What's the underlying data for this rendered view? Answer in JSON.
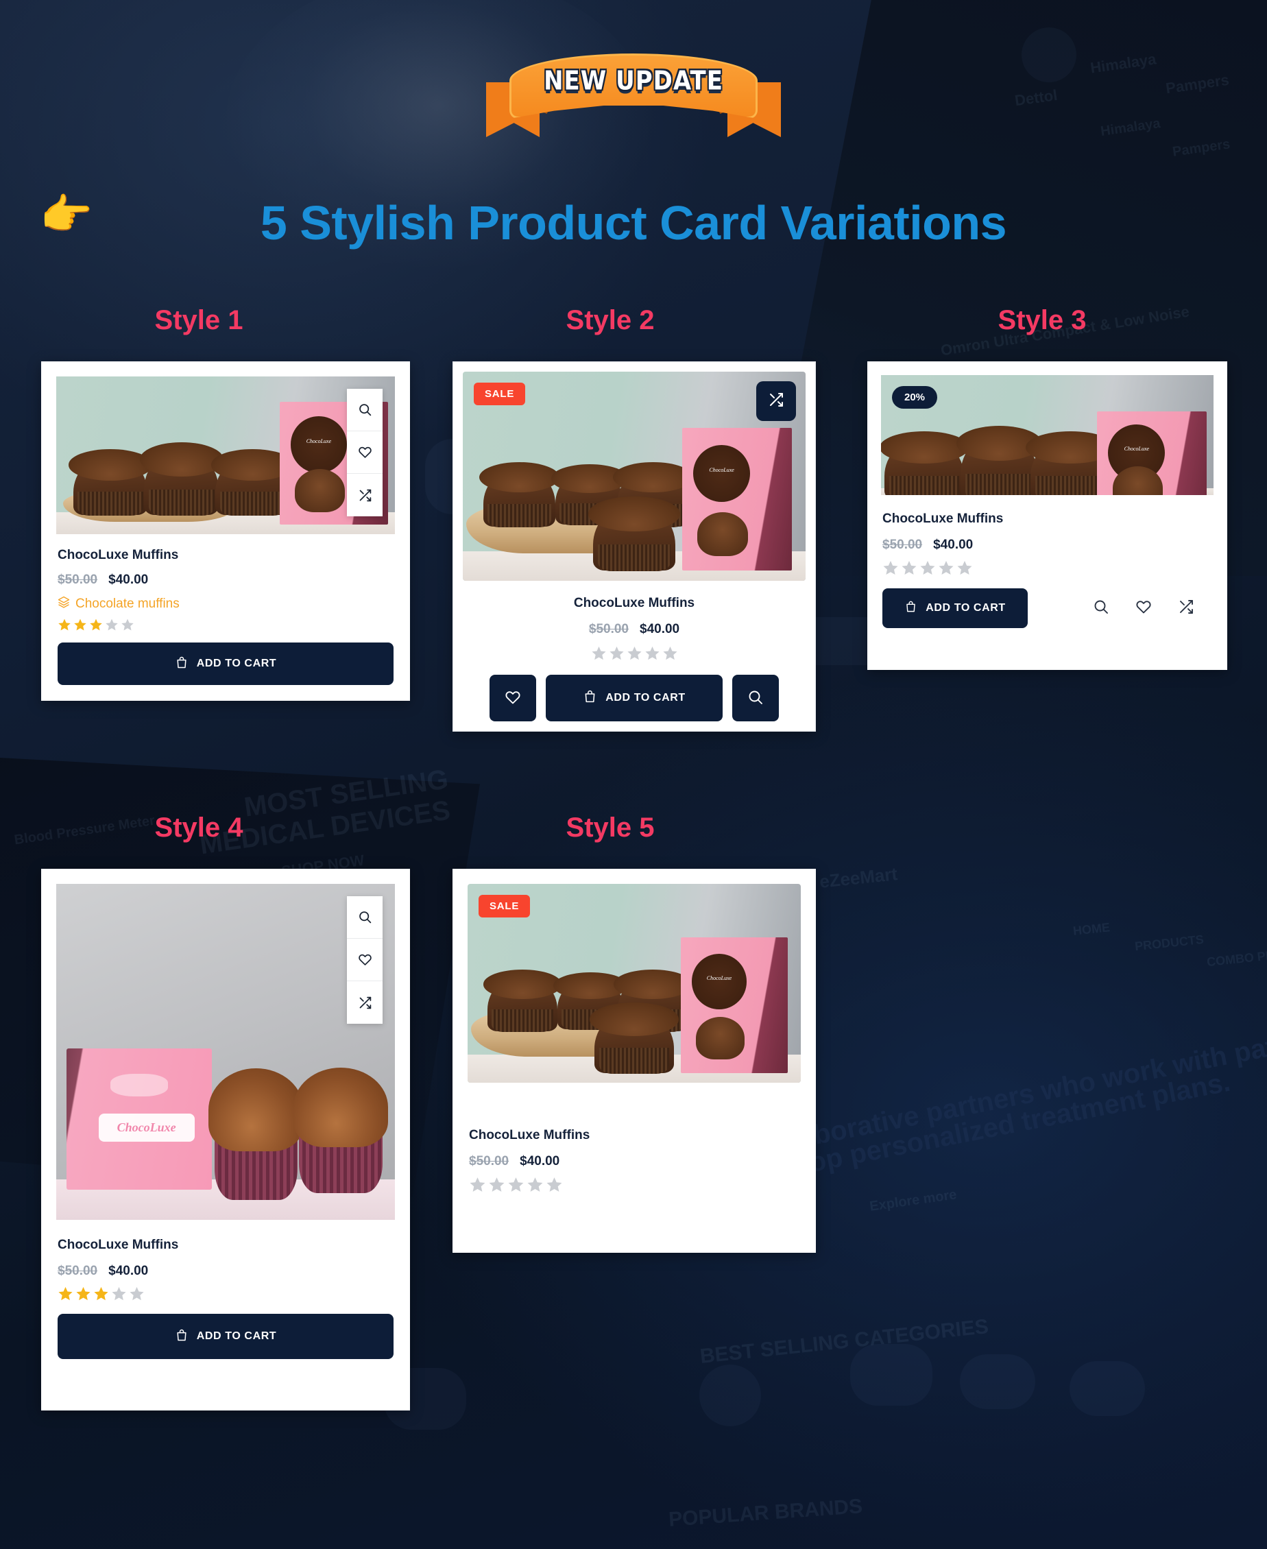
{
  "banner": {
    "text": "NEW UPDATE"
  },
  "header": {
    "pointer_icon": "pointing-hand-icon",
    "title": "5 Stylish Product Card Variations",
    "title_color": "#1a8fd8"
  },
  "labels": {
    "style1": "Style 1",
    "style2": "Style 2",
    "style3": "Style 3",
    "style4": "Style 4",
    "style5": "Style 5",
    "color": "#f43a63"
  },
  "product": {
    "name": "ChocoLuxe Muffins",
    "price_old": "$50.00",
    "price_new": "$40.00",
    "category": "Chocolate muffins",
    "add_to_cart": "ADD TO CART"
  },
  "badges": {
    "sale": "SALE",
    "discount": "20%",
    "sale_color": "#f8442e",
    "discount_color": "#0d1d38"
  },
  "ratings": {
    "style1_filled": 3,
    "style2_filled": 0,
    "style3_filled": 0,
    "style4_filled": 3,
    "style5_filled": 0,
    "total": 5,
    "filled_color": "#f5b518",
    "empty_color": "#c9ccd1"
  },
  "icons": {
    "search": "search-icon",
    "wishlist": "heart-icon",
    "compare": "shuffle-compare-icon",
    "cart": "shopping-bag-icon",
    "category": "layers-stack-icon"
  },
  "theme": {
    "page_bg": "#0d1a2e",
    "card_bg": "#ffffff",
    "button_bg": "#0d1d38",
    "category_color": "#f4a427"
  },
  "background_text": {
    "t1": "Dettol",
    "t2": "Himalaya",
    "t3": "Pampers",
    "t4": "MOST SELLING",
    "t5": "MEDICAL DEVICES",
    "t6": "SHOP NOW",
    "t7": "Omron Ultra Compact & Low Noise",
    "t8": "eZeeMart",
    "t9": "HOME",
    "t10": "PRODUCTS",
    "t11": "COMBO PR",
    "t12": "borative partners who work with patients",
    "t13": "op personalized treatment plans.",
    "t14": "Explore more",
    "t15": "BEST SELLING CATEGORIES",
    "t16": "POPULAR BRANDS",
    "t17": "Blood Pressure Meter"
  }
}
